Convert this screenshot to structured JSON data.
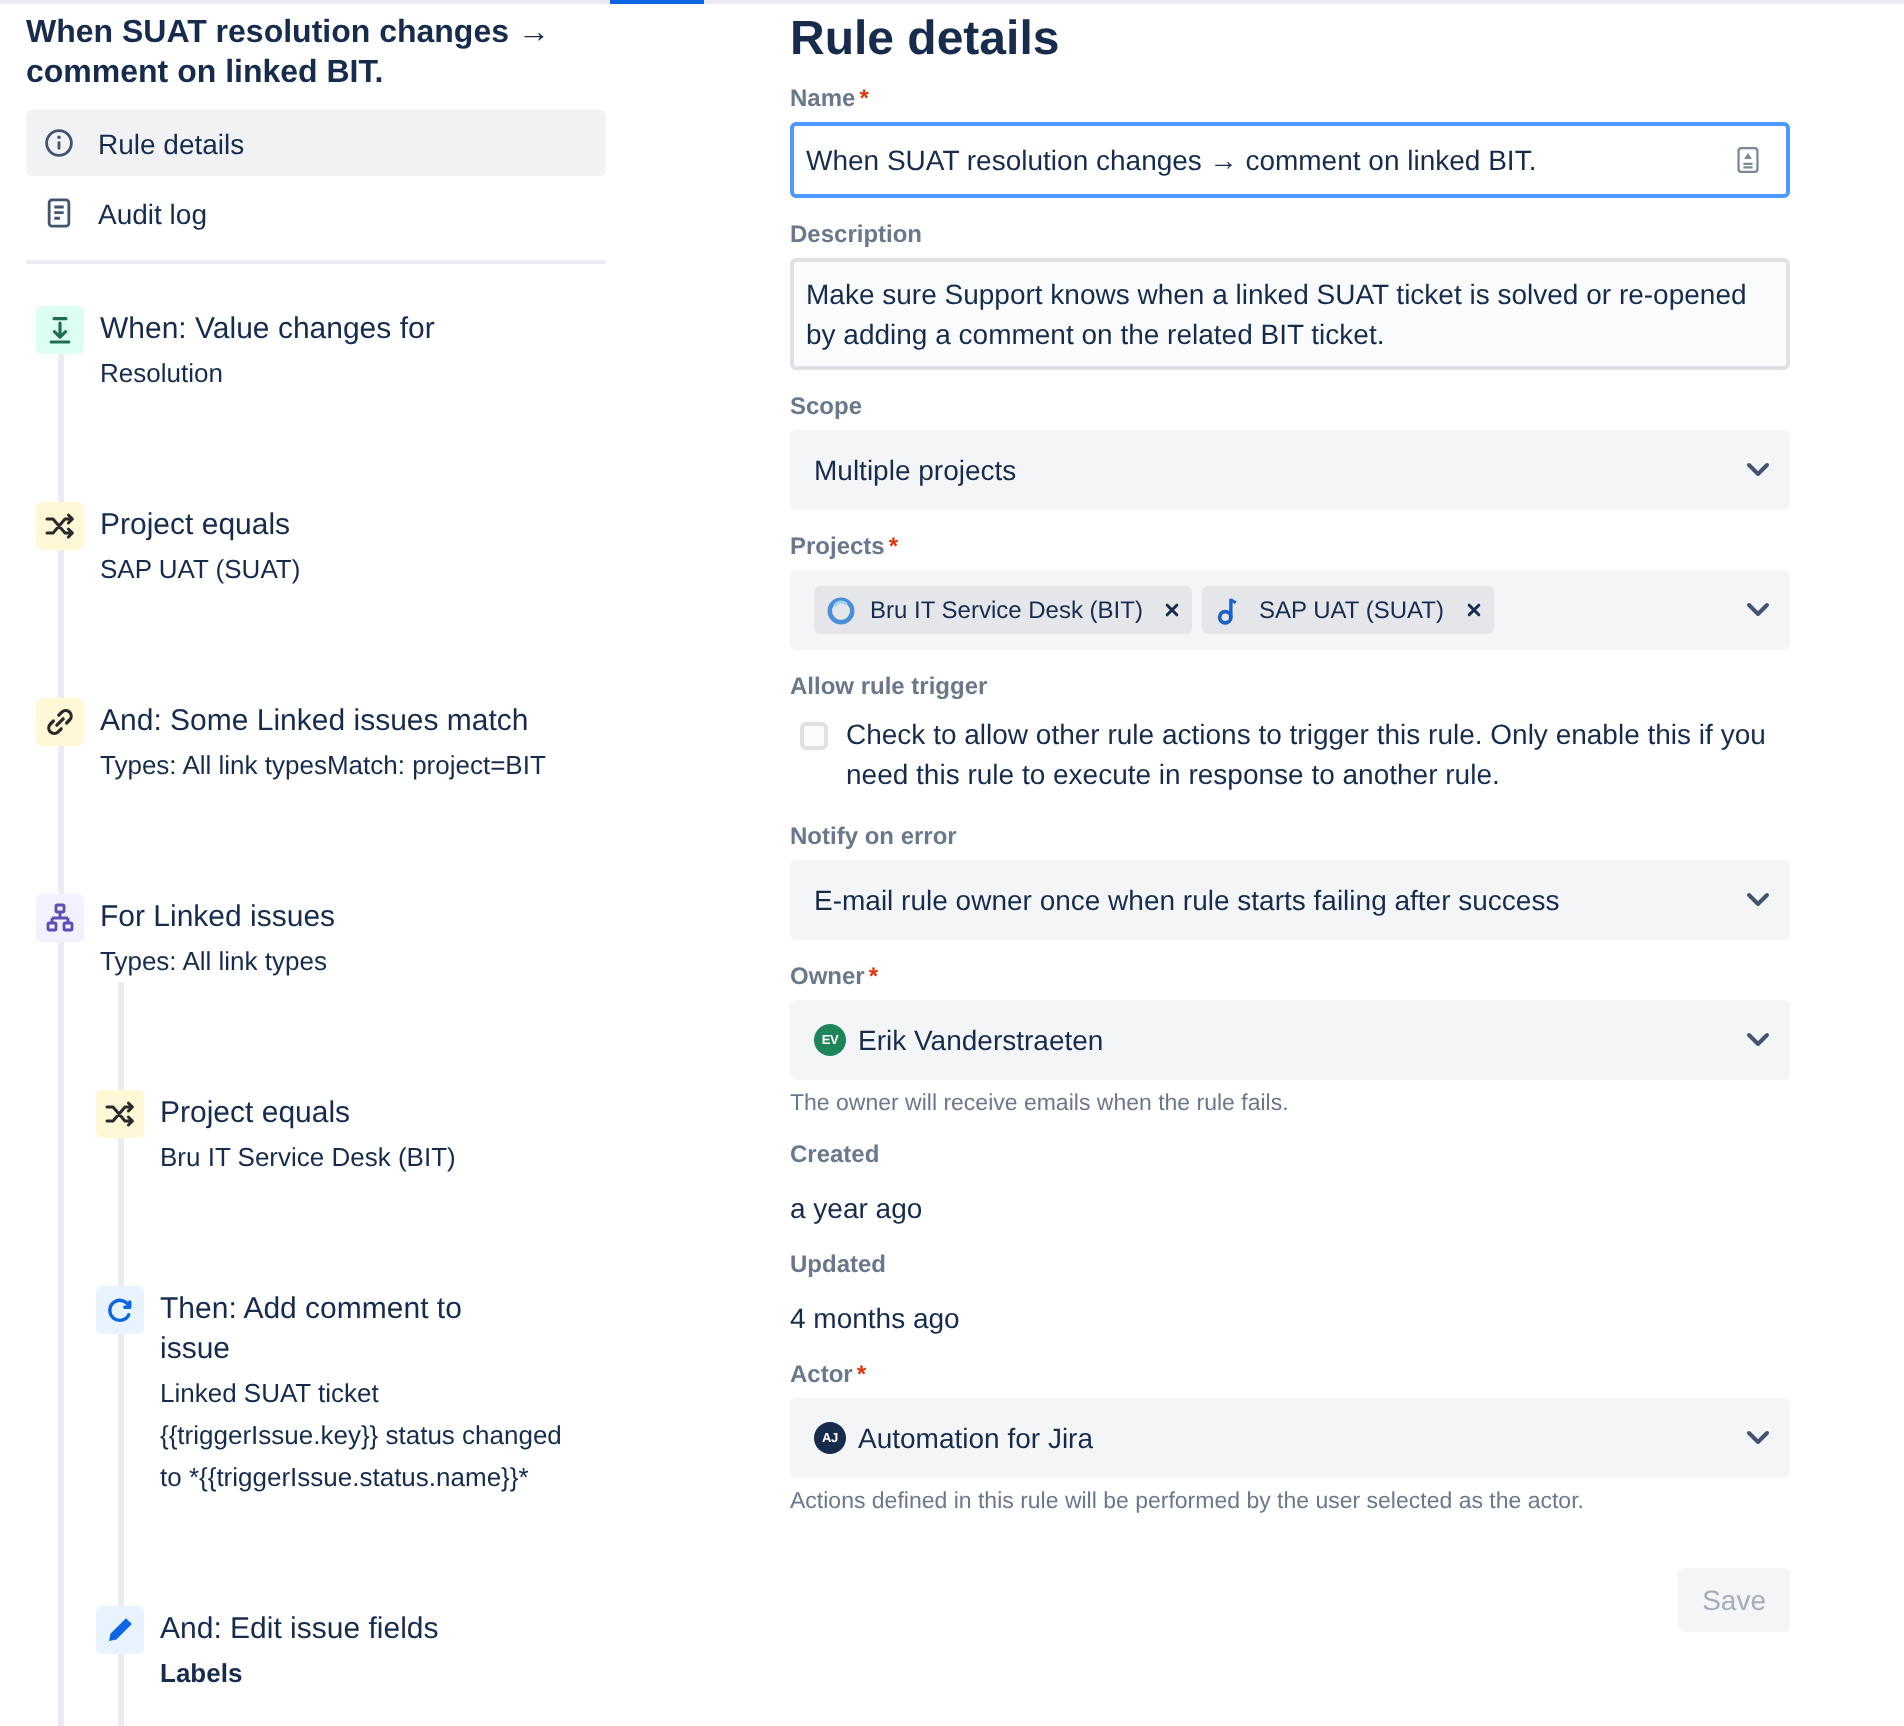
{
  "sidebar": {
    "title": "When SUAT resolution changes → comment on linked BIT.",
    "nav": [
      {
        "kind": "info",
        "label": "Rule details",
        "selected": true
      },
      {
        "kind": "document",
        "label": "Audit log",
        "selected": false
      }
    ],
    "steps": [
      {
        "kind": "trigger",
        "title": "When: Value changes for",
        "detail": "Resolution"
      },
      {
        "kind": "condition",
        "title": "Project equals",
        "detail": "SAP UAT (SUAT)"
      },
      {
        "kind": "linked-condition",
        "title": "And: Some Linked issues match",
        "detail": "Types: All link typesMatch: project=BIT"
      },
      {
        "kind": "branch",
        "title": "For Linked issues",
        "detail": "Types: All link types",
        "children": [
          {
            "kind": "condition",
            "title": "Project equals",
            "detail": "Bru IT Service Desk (BIT)"
          },
          {
            "kind": "comment-action",
            "title": "Then: Add comment to issue",
            "detail": "Linked SUAT ticket {{triggerIssue.key}} status changed to *{{triggerIssue.status.name}}*"
          },
          {
            "kind": "edit-action",
            "title": "And: Edit issue fields",
            "fields": [
              "Labels"
            ]
          }
        ]
      }
    ]
  },
  "form": {
    "heading": "Rule details",
    "fields": [
      {
        "kind": "text",
        "label": "Name",
        "required_mark": "*",
        "value": "When SUAT resolution changes → comment on linked BIT.",
        "focused": true
      },
      {
        "kind": "textarea",
        "label": "Description",
        "value": "Make sure Support knows when a linked SUAT ticket is solved or re-opened by adding a comment on the related BIT ticket.",
        "focused": false
      },
      {
        "kind": "select",
        "label": "Scope",
        "value": "Multiple projects"
      },
      {
        "kind": "multi-select",
        "label": "Projects",
        "required_mark": "*",
        "tags": [
          {
            "kind": "ring",
            "label": "Bru IT Service Desk (BIT)"
          },
          {
            "kind": "note",
            "label": "SAP UAT (SUAT)"
          }
        ]
      },
      {
        "kind": "checkbox",
        "label": "Allow rule trigger",
        "checked": false,
        "text": "Check to allow other rule actions to trigger this rule. Only enable this if you need this rule to execute in response to another rule."
      },
      {
        "kind": "select",
        "label": "Notify on error",
        "value": "E-mail rule owner once when rule starts failing after success"
      },
      {
        "kind": "user-select",
        "label": "Owner",
        "required_mark": "*",
        "avatar": {
          "initials": "EV",
          "color": "#1f845a"
        },
        "value": "Erik Vanderstraeten",
        "help": "The owner will receive emails when the rule fails."
      },
      {
        "kind": "static",
        "label": "Created",
        "value": "a year ago"
      },
      {
        "kind": "static",
        "label": "Updated",
        "value": "4 months ago"
      },
      {
        "kind": "user-select",
        "label": "Actor",
        "required_mark": "*",
        "avatar": {
          "initials": "AJ",
          "color": "#172b4d"
        },
        "value": "Automation for Jira",
        "help": "Actions defined in this rule will be performed by the user selected as the actor."
      }
    ]
  },
  "save_button": {
    "label": "Save",
    "disabled": true
  }
}
